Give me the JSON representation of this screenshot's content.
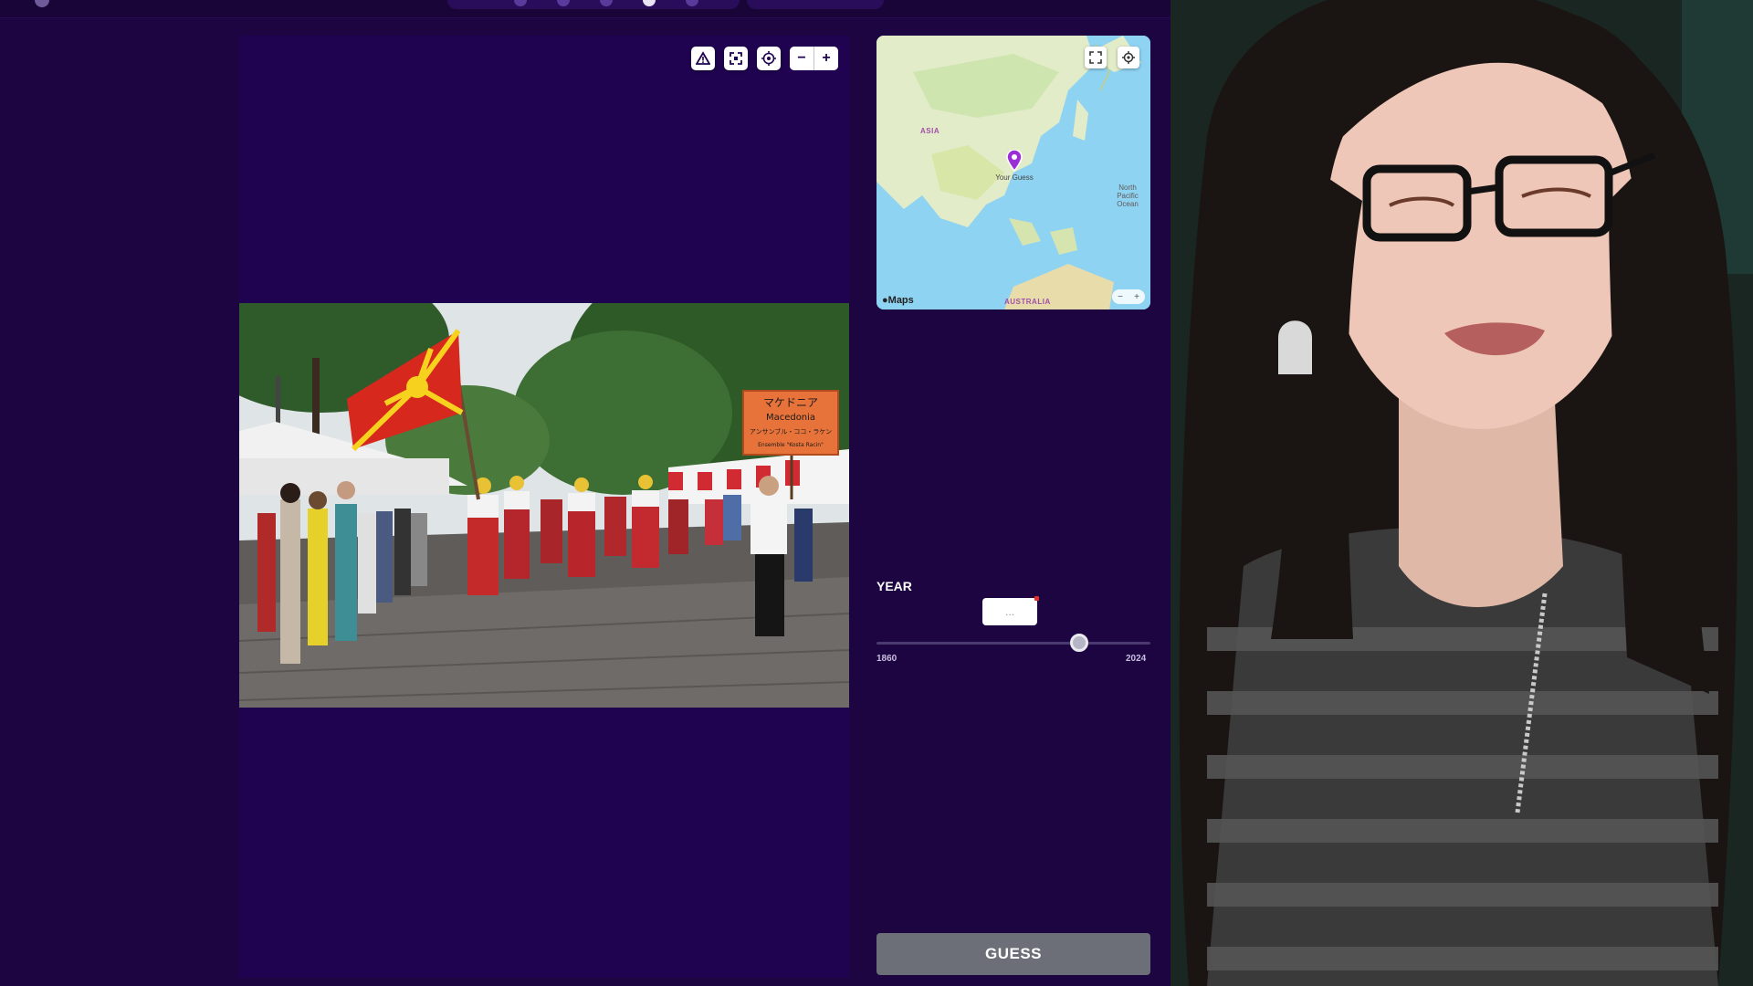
{
  "viewer": {
    "toolbar": {
      "report_icon": "warning-triangle-icon",
      "fullscreen_icon": "expand-icon",
      "fit_icon": "recenter-icon",
      "zoom_out_label": "−",
      "zoom_in_label": "+"
    }
  },
  "map": {
    "region_label_asia": "ASIA",
    "region_label_australia": "AUSTRALIA",
    "pin_label": "Your Guess",
    "ocean_label": "North Pacific Ocean",
    "attribution": "Maps",
    "zoom_out": "−",
    "zoom_in": "+"
  },
  "year": {
    "label": "YEAR",
    "value_placeholder": "...",
    "min": "1860",
    "max": "2024",
    "current_fraction": 0.74
  },
  "guess": {
    "label": "GUESS"
  },
  "photo": {
    "sign_line_1": "マケドニア",
    "sign_line_2": "Macedonia",
    "sign_line_3": "アンサンブル・ココ・ラケン",
    "sign_line_4": "Ensemble \"Kosta Racin\""
  },
  "colors": {
    "background": "#1c0540",
    "panel": "#1f0350",
    "button_disabled": "#6c6f78",
    "map_water": "#8fd3f2",
    "map_land": "#e3ecc8",
    "pin": "#9b2fd6"
  }
}
